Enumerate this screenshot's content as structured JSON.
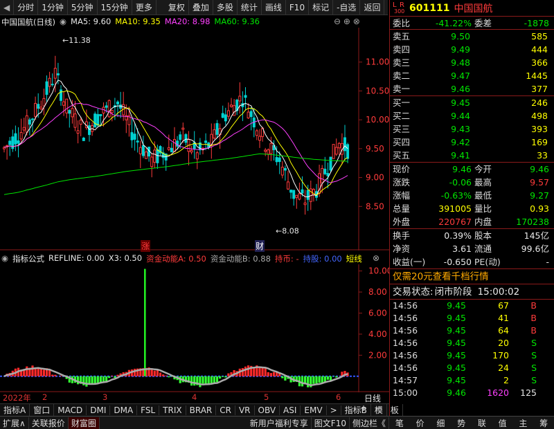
{
  "toolbar": {
    "periods": [
      "分时",
      "1分钟",
      "5分钟",
      "15分钟",
      "更多"
    ],
    "actions": [
      "复权",
      "叠加",
      "多股",
      "统计",
      "画线",
      "F10",
      "标记",
      "-自选",
      "返回"
    ]
  },
  "main_chart": {
    "title": "中国国航(日线)",
    "ma5": "MA5: 9.60",
    "ma10": "MA10: 9.35",
    "ma20": "MA20: 8.98",
    "ma60": "MA60: 9.36",
    "high_mark": "11.38",
    "low_mark": "8.08",
    "price_axis": [
      "11.00",
      "10.50",
      "10.00",
      "9.50",
      "9.00",
      "8.50"
    ],
    "tag_zhang": "涨",
    "tag_cai": "财"
  },
  "indicator": {
    "name": "指标公式",
    "refline": "REFLINE: 0.00",
    "x3": "X3: 0.50",
    "fa": "资金动能A: 0.50",
    "fb": "资金动能B: 0.88",
    "chi": "持币: -",
    "chicang": "持股: 0.00",
    "short": "短线",
    "axis": [
      "10.00",
      "8.00",
      "6.00",
      "4.00",
      "2.00"
    ]
  },
  "dates": {
    "year": "2022年",
    "m2": "2",
    "m3": "3",
    "m4": "4",
    "m5": "5",
    "m6": "6",
    "daily": "日线"
  },
  "tabs": [
    "指标A",
    "窗口",
    "MACD",
    "DMI",
    "DMA",
    "FSL",
    "TRIX",
    "BRAR",
    "CR",
    "VR",
    "OBV",
    "ASI",
    "EMV",
    "指标B",
    "模",
    "板"
  ],
  "status": [
    "扩展∧",
    "关联报价",
    "财富圈",
    "新用户福利专享",
    "图文F10",
    "侧边栏《"
  ],
  "stock": {
    "code": "601111",
    "name": "中国国航",
    "badge_l": "L",
    "badge_r": "R",
    "badge_num": "300"
  },
  "weibi": {
    "label": "委比",
    "value": "-41.22%",
    "label2": "委差",
    "value2": "-1878"
  },
  "asks": [
    {
      "label": "卖五",
      "price": "9.50",
      "vol": "585"
    },
    {
      "label": "卖四",
      "price": "9.49",
      "vol": "444"
    },
    {
      "label": "卖三",
      "price": "9.48",
      "vol": "366"
    },
    {
      "label": "卖二",
      "price": "9.47",
      "vol": "1445"
    },
    {
      "label": "卖一",
      "price": "9.46",
      "vol": "377"
    }
  ],
  "bids": [
    {
      "label": "买一",
      "price": "9.45",
      "vol": "246"
    },
    {
      "label": "买二",
      "price": "9.44",
      "vol": "498"
    },
    {
      "label": "买三",
      "price": "9.43",
      "vol": "393"
    },
    {
      "label": "买四",
      "price": "9.42",
      "vol": "169"
    },
    {
      "label": "买五",
      "price": "9.41",
      "vol": "33"
    }
  ],
  "quote": [
    {
      "l1": "现价",
      "v1": "9.46",
      "c1": "green",
      "l2": "今开",
      "v2": "9.46",
      "c2": "green"
    },
    {
      "l1": "涨跌",
      "v1": "-0.06",
      "c1": "green",
      "l2": "最高",
      "v2": "9.57",
      "c2": "red"
    },
    {
      "l1": "涨幅",
      "v1": "-0.63%",
      "c1": "green",
      "l2": "最低",
      "v2": "9.27",
      "c2": "green"
    },
    {
      "l1": "总量",
      "v1": "391005",
      "c1": "yellow",
      "l2": "量比",
      "v2": "0.93",
      "c2": "yellow"
    },
    {
      "l1": "外盘",
      "v1": "220767",
      "c1": "red",
      "l2": "内盘",
      "v2": "170238",
      "c2": "green"
    }
  ],
  "fund": [
    {
      "l1": "换手",
      "v1": "0.39%",
      "l2": "股本",
      "v2": "145亿"
    },
    {
      "l1": "净资",
      "v1": "3.61",
      "l2": "流通",
      "v2": "99.6亿"
    },
    {
      "l1": "收益(一)",
      "v1": "-0.650",
      "l2": "PE(动)",
      "v2": "-"
    }
  ],
  "promo": "仅需20元查看千档行情",
  "trade_status": {
    "label": "交易状态:",
    "value": "闭市阶段",
    "time": "15:00:02"
  },
  "ticks": [
    {
      "t": "14:56",
      "p": "9.45",
      "v": "67",
      "d": "B"
    },
    {
      "t": "14:56",
      "p": "9.45",
      "v": "41",
      "d": "B"
    },
    {
      "t": "14:56",
      "p": "9.45",
      "v": "64",
      "d": "B"
    },
    {
      "t": "14:56",
      "p": "9.45",
      "v": "20",
      "d": "S"
    },
    {
      "t": "14:56",
      "p": "9.45",
      "v": "170",
      "d": "S"
    },
    {
      "t": "14:56",
      "p": "9.45",
      "v": "24",
      "d": "S"
    },
    {
      "t": "14:57",
      "p": "9.45",
      "v": "2",
      "d": "S"
    },
    {
      "t": "15:00",
      "p": "9.46",
      "v": "1620",
      "d": "125"
    }
  ],
  "rp_foot": [
    "笔",
    "价",
    "细",
    "势",
    "联",
    "值",
    "主",
    "筹"
  ],
  "colors": {
    "up": "#ff3b3b",
    "down": "#00e600",
    "ma5": "#ffffff",
    "ma10": "#ffff00",
    "ma20": "#ff40ff",
    "ma60": "#00e600",
    "grid": "#8b1a1a"
  }
}
